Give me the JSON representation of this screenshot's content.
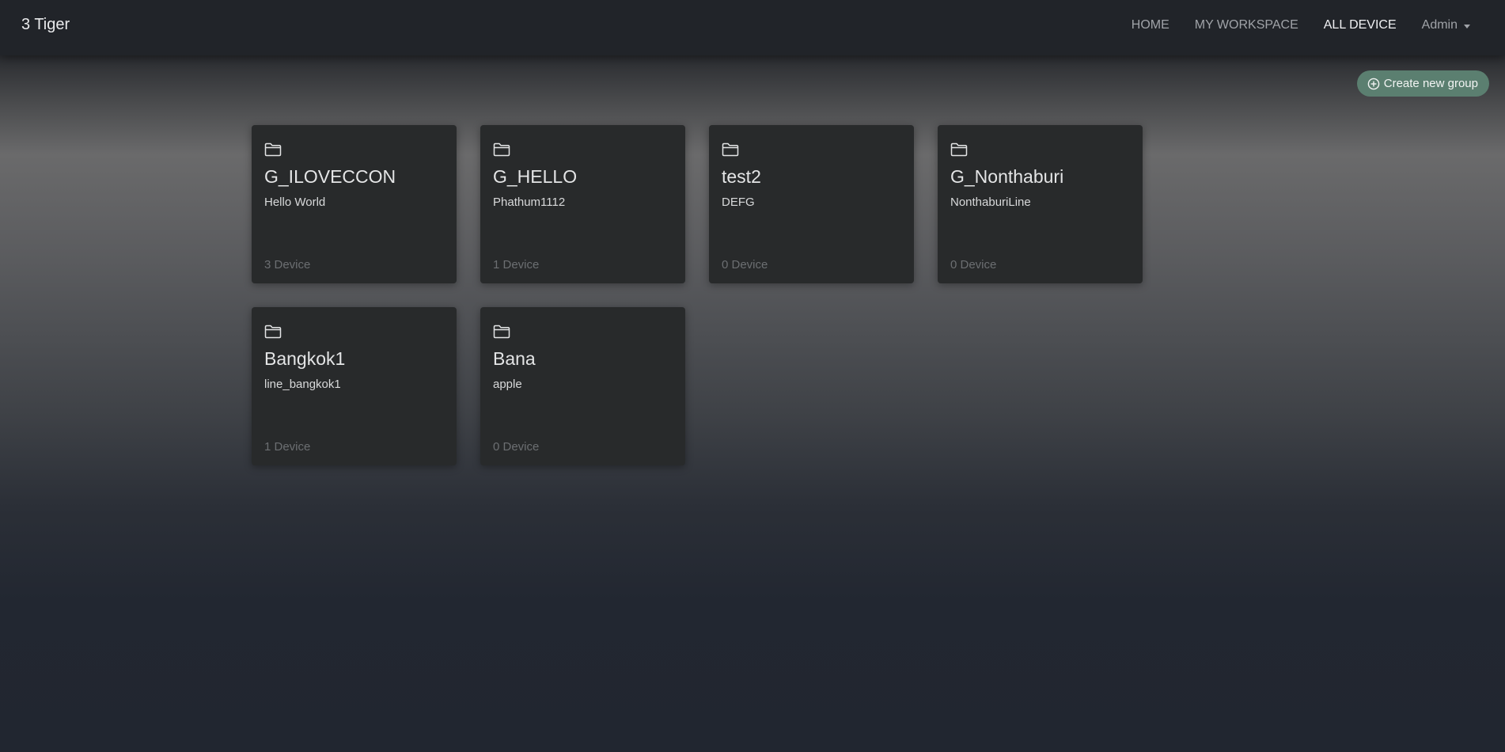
{
  "navbar": {
    "brand": "3 Tiger",
    "links": [
      {
        "label": "HOME"
      },
      {
        "label": "MY WORKSPACE"
      },
      {
        "label": "ALL DEVICE"
      }
    ],
    "user_menu": "Admin"
  },
  "actions": {
    "create_label": "Create new group"
  },
  "groups": [
    {
      "name": "G_ILOVECCON",
      "description": "Hello World",
      "count": "3 Device"
    },
    {
      "name": "G_HELLO",
      "description": "Phathum1112",
      "count": "1 Device"
    },
    {
      "name": "test2",
      "description": "DEFG",
      "count": "0 Device"
    },
    {
      "name": "G_Nonthaburi",
      "description": "NonthaburiLine",
      "count": "0 Device"
    },
    {
      "name": "Bangkok1",
      "description": "line_bangkok1",
      "count": "1 Device"
    },
    {
      "name": "Bana",
      "description": "apple",
      "count": "0 Device"
    }
  ],
  "colors": {
    "navbar_bg": "#212429",
    "card_bg": "#282a2b",
    "accent_button": "#5b7f70"
  }
}
